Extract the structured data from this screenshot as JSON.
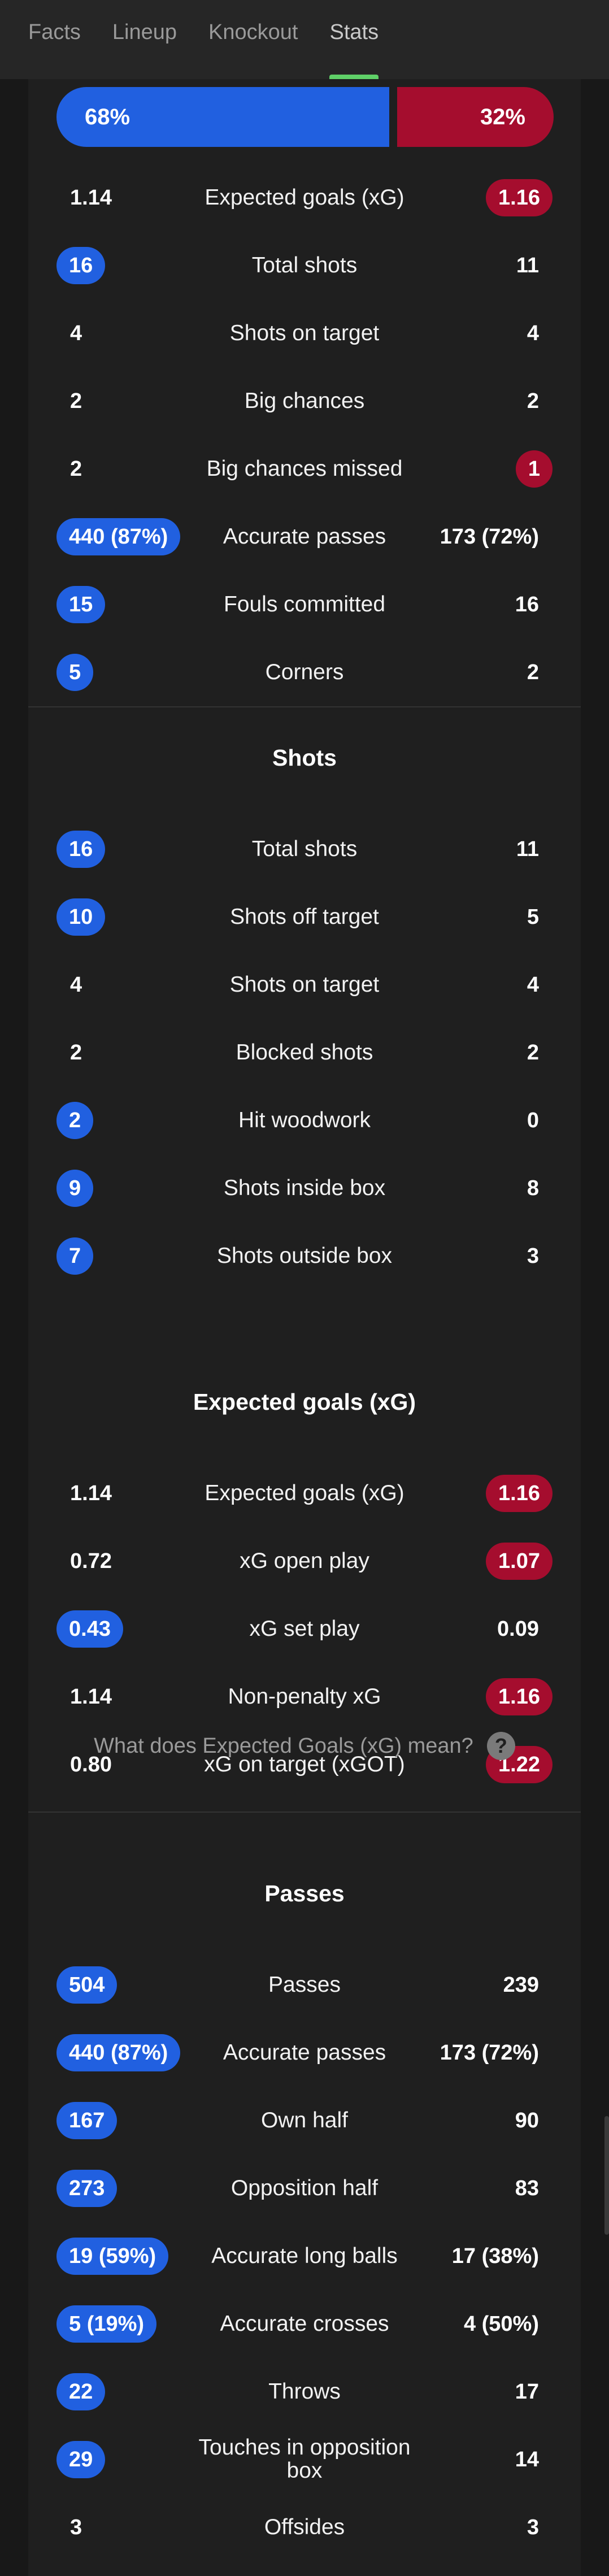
{
  "nav": {
    "tabs": [
      "Facts",
      "Lineup",
      "Knockout",
      "Stats"
    ]
  },
  "colors": {
    "home": "#2160e0",
    "away": "#a50d2e",
    "active_tab": "#5fd068"
  },
  "possession": {
    "home": "68%",
    "away": "32%",
    "home_fraction": 0.68
  },
  "top_stats": [
    {
      "label": "Expected goals (xG)",
      "home": "1.14",
      "away": "1.16",
      "highlight": "away"
    },
    {
      "label": "Total shots",
      "home": "16",
      "away": "11",
      "highlight": "home"
    },
    {
      "label": "Shots on target",
      "home": "4",
      "away": "4",
      "highlight": "none"
    },
    {
      "label": "Big chances",
      "home": "2",
      "away": "2",
      "highlight": "none"
    },
    {
      "label": "Big chances missed",
      "home": "2",
      "away": "1",
      "highlight": "away"
    },
    {
      "label": "Accurate passes",
      "home": "440 (87%)",
      "away": "173 (72%)",
      "highlight": "home"
    },
    {
      "label": "Fouls committed",
      "home": "15",
      "away": "16",
      "highlight": "home"
    },
    {
      "label": "Corners",
      "home": "5",
      "away": "2",
      "highlight": "home"
    }
  ],
  "shots": {
    "title": "Shots",
    "rows": [
      {
        "label": "Total shots",
        "home": "16",
        "away": "11",
        "highlight": "home"
      },
      {
        "label": "Shots off target",
        "home": "10",
        "away": "5",
        "highlight": "home"
      },
      {
        "label": "Shots on target",
        "home": "4",
        "away": "4",
        "highlight": "none"
      },
      {
        "label": "Blocked shots",
        "home": "2",
        "away": "2",
        "highlight": "none"
      },
      {
        "label": "Hit woodwork",
        "home": "2",
        "away": "0",
        "highlight": "home"
      },
      {
        "label": "Shots inside box",
        "home": "9",
        "away": "8",
        "highlight": "home"
      },
      {
        "label": "Shots outside box",
        "home": "7",
        "away": "3",
        "highlight": "home"
      }
    ]
  },
  "xg": {
    "title": "Expected goals (xG)",
    "rows": [
      {
        "label": "Expected goals (xG)",
        "home": "1.14",
        "away": "1.16",
        "highlight": "away"
      },
      {
        "label": "xG open play",
        "home": "0.72",
        "away": "1.07",
        "highlight": "away"
      },
      {
        "label": "xG set play",
        "home": "0.43",
        "away": "0.09",
        "highlight": "home"
      },
      {
        "label": "Non-penalty xG",
        "home": "1.14",
        "away": "1.16",
        "highlight": "away"
      },
      {
        "label": "xG on target (xGOT)",
        "home": "0.80",
        "away": "1.22",
        "highlight": "away"
      }
    ],
    "help_text": "What does Expected Goals (xG) mean?",
    "help_icon": "question-icon"
  },
  "passes": {
    "title": "Passes",
    "rows": [
      {
        "label": "Passes",
        "home": "504",
        "away": "239",
        "highlight": "home"
      },
      {
        "label": "Accurate passes",
        "home": "440 (87%)",
        "away": "173 (72%)",
        "highlight": "home"
      },
      {
        "label": "Own half",
        "home": "167",
        "away": "90",
        "highlight": "home"
      },
      {
        "label": "Opposition half",
        "home": "273",
        "away": "83",
        "highlight": "home"
      },
      {
        "label": "Accurate long balls",
        "home": "19 (59%)",
        "away": "17 (38%)",
        "highlight": "home"
      },
      {
        "label": "Accurate crosses",
        "home": "5 (19%)",
        "away": "4 (50%)",
        "highlight": "home"
      },
      {
        "label": "Throws",
        "home": "22",
        "away": "17",
        "highlight": "home"
      },
      {
        "label": "Touches in opposition box",
        "home": "29",
        "away": "14",
        "highlight": "home"
      },
      {
        "label": "Offsides",
        "home": "3",
        "away": "3",
        "highlight": "none"
      }
    ]
  }
}
